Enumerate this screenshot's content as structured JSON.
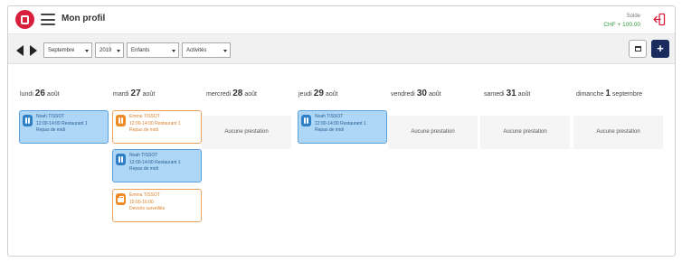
{
  "header": {
    "title": "Mon profil",
    "solde_label": "Solde",
    "solde_value": "CHF + 100.00"
  },
  "toolbar": {
    "month": "Septembre",
    "year": "2019",
    "children": "Enfants",
    "activities": "Activités"
  },
  "days": [
    {
      "weekday": "lundi",
      "num": "26",
      "month": "août"
    },
    {
      "weekday": "mardi",
      "num": "27",
      "month": "août"
    },
    {
      "weekday": "mercredi",
      "num": "28",
      "month": "août"
    },
    {
      "weekday": "jeudi",
      "num": "29",
      "month": "août"
    },
    {
      "weekday": "vendredi",
      "num": "30",
      "month": "août"
    },
    {
      "weekday": "samedi",
      "num": "31",
      "month": "août"
    },
    {
      "weekday": "dimanche",
      "num": "1",
      "month": "septembre"
    }
  ],
  "empty_label": "Aucune prestation",
  "events": {
    "mon_1": {
      "name": "Noah TISSOT",
      "time": "12:00-14:00 Restaurant 1",
      "type": "Repas de midi"
    },
    "tue_1": {
      "name": "Emma TISSOT",
      "time": "12:00-14:00 Restaurant 1",
      "type": "Repas de midi"
    },
    "tue_2": {
      "name": "Noah TISSOT",
      "time": "12:00-14:00 Restaurant 1",
      "type": "Repas de midi"
    },
    "tue_3": {
      "name": "Emma TISSOT",
      "time": "15:00-16:00",
      "type": "Devoirs surveillés"
    },
    "thu_1": {
      "name": "Noah TISSOT",
      "time": "12:00-14:00 Restaurant 1",
      "type": "Repas de midi"
    }
  },
  "colors": {
    "brand_red": "#d81f3c",
    "navy": "#1a2b5e",
    "card_blue": "#add6f7",
    "card_orange_border": "#f0a35c",
    "solde_green": "#2e9a3c"
  },
  "icons": [
    "app-logo-icon",
    "menu-icon",
    "logout-icon",
    "prev-arrow-icon",
    "next-arrow-icon",
    "calendar-icon",
    "plus-icon",
    "cutlery-icon",
    "schoolbag-icon"
  ]
}
